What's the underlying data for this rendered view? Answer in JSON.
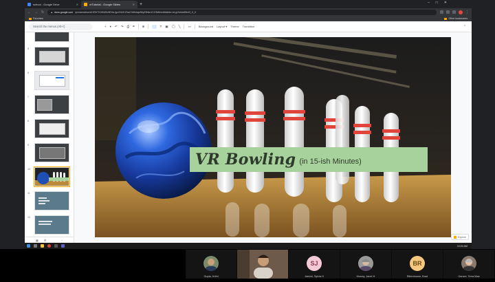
{
  "browser": {
    "tabs": [
      {
        "title": "school - Google Drive",
        "favicon_color": "#4285f4",
        "active": false
      },
      {
        "title": "vrTutorial - Google Slides",
        "favicon_color": "#f9ab00",
        "active": true
      }
    ],
    "new_tab": "+",
    "window_buttons": [
      "–",
      "□",
      "✕"
    ],
    "url_host": "docs.google.com",
    "url_path": "/presentation/d/1RHTKXB4Ek9EXlcJgxCNVKZ0aC0Wt4ajzfMyZ9hilo1CZ3Mh/edit#slide=id.g10d4e85b43_0_0",
    "bookmarks": {
      "favorites": "Favorites",
      "other": "Other bookmarks"
    }
  },
  "slides": {
    "menu_search_placeholder": "Search the menus (Alt+/)",
    "toolbar": {
      "new": "+",
      "undo": "↶",
      "redo": "↷",
      "print": "⎙",
      "paint": "⌗",
      "zoom": "⊕",
      "select": "⬚",
      "textbox": "T",
      "image": "▣",
      "shape": "◯",
      "line": "╲",
      "comment": "▭",
      "background": "Background",
      "layout": "Layout ▾",
      "theme": "Theme",
      "transition": "Transition",
      "collapse": "⌃"
    },
    "filmstrip": {
      "slides": [
        {
          "num": "",
          "kind": "dark"
        },
        {
          "num": "5",
          "kind": "dark"
        },
        {
          "num": "6",
          "kind": "light"
        },
        {
          "num": "7",
          "kind": "dark"
        },
        {
          "num": "8",
          "kind": "dark"
        },
        {
          "num": "9",
          "kind": "dark"
        },
        {
          "num": "10",
          "kind": "bowling",
          "active": true
        },
        {
          "num": "11",
          "kind": "blue"
        },
        {
          "num": "12",
          "kind": "blue"
        }
      ],
      "footer": {
        "grid": "▦",
        "list": "☰",
        "collapse": "‹"
      }
    },
    "current_slide": {
      "title": "VR Bowling",
      "subtitle": "(in 15-ish Minutes)",
      "banner_color": "#a8d29b"
    },
    "explore_label": "Explore"
  },
  "taskbar": {
    "clock": "10:04 AM"
  },
  "meeting": {
    "participants": [
      {
        "name": "Gupta, Krithi",
        "initials": "",
        "avatar_color": "#7a8a6a"
      },
      {
        "name": "",
        "initials": "",
        "avatar_color": "#6d5a4b",
        "video": true
      },
      {
        "name": "Janicki, Sylvia H",
        "initials": "SJ",
        "avatar_color": "#f5c9d5"
      },
      {
        "name": "Murray, Janet H",
        "initials": "",
        "avatar_color": "#9a9a9a"
      },
      {
        "name": "Rittenhouse, Brad",
        "initials": "BR",
        "avatar_color": "#f6c77e"
      },
      {
        "name": "Ganzer, Terra Mae",
        "initials": "",
        "avatar_color": "#8a7a6e"
      }
    ]
  }
}
